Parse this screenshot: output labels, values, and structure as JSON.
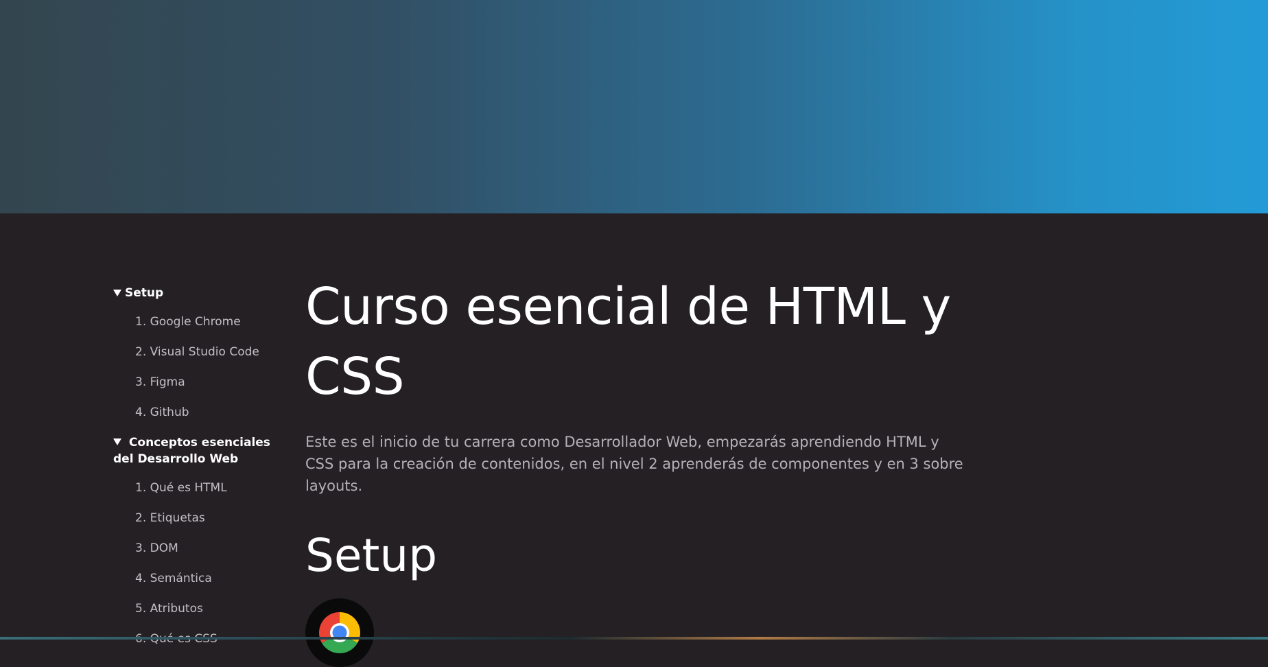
{
  "sidebar": {
    "sections": [
      {
        "title": "Setup",
        "items": [
          "1. Google Chrome",
          "2. Visual Studio Code",
          "3. Figma",
          "4. Github"
        ]
      },
      {
        "title": "Conceptos esenciales del Desarrollo Web",
        "items": [
          "1. Qué es HTML",
          "2. Etiquetas",
          "3. DOM",
          "4. Semántica",
          "5. Atributos",
          "6. Qué es CSS"
        ]
      }
    ]
  },
  "main": {
    "title": "Curso esencial de HTML y CSS",
    "intro": "Este es el inicio de tu carrera como Desarrollador Web, empezarás aprendiendo HTML y CSS para la creación de contenidos, en el nivel 2 aprenderás de componentes y en 3 sobre layouts.",
    "section_heading": "Setup",
    "first_item_icon": "google-chrome-icon"
  },
  "colors": {
    "hero_start": "#33464f",
    "hero_end": "#249bd6",
    "background": "#242024",
    "text_primary": "#ffffff",
    "text_secondary": "#b7b1b7"
  }
}
